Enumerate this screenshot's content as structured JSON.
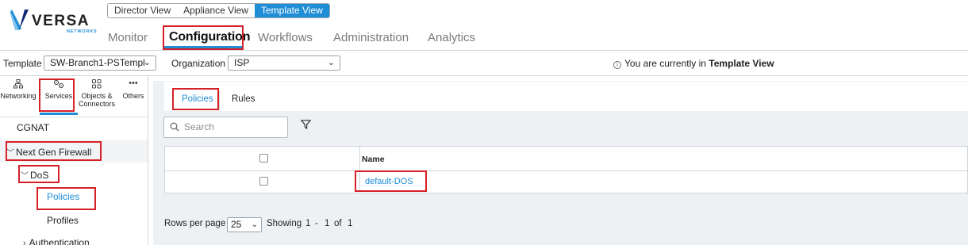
{
  "brand": {
    "name": "VERSA",
    "sub": "NETWORKS",
    "colors": [
      "#0e2a74",
      "#1f8ed6",
      "#7ec2ee"
    ]
  },
  "view_switch": {
    "items": [
      "Director View",
      "Appliance View",
      "Template View"
    ],
    "active": "Template View"
  },
  "main_nav": {
    "items": [
      "Monitor",
      "Configuration",
      "Workflows",
      "Administration",
      "Analytics"
    ],
    "active": "Configuration"
  },
  "context_bar": {
    "template_label": "Template",
    "template_value": "SW-Branch1-PSTempl",
    "org_label": "Organization",
    "org_value": "ISP",
    "info_prefix": "You are currently in",
    "info_view": "Template View"
  },
  "categories": [
    {
      "label": "Networking",
      "icon": "network-icon"
    },
    {
      "label": "Services",
      "icon": "services-icon"
    },
    {
      "label": "Objects & Connectors",
      "label_line1": "Objects &",
      "label_line2": "Connectors",
      "icon": "objects-icon"
    },
    {
      "label": "Others",
      "icon": "more-icon"
    }
  ],
  "active_category": "Services",
  "tree": {
    "cgnat": "CGNAT",
    "ngfw": "Next Gen Firewall",
    "dos": "DoS",
    "policies": "Policies",
    "profiles": "Profiles",
    "authentication": "Authentication"
  },
  "content_tabs": {
    "items": [
      "Policies",
      "Rules"
    ],
    "active": "Policies"
  },
  "search": {
    "placeholder": "Search"
  },
  "table": {
    "columns": [
      "",
      "Name"
    ],
    "rows": [
      {
        "name": "default-DOS"
      }
    ]
  },
  "pagination": {
    "rows_per_page_label": "Rows per page",
    "rows_per_page": "25",
    "showing_label": "Showing",
    "from": "1",
    "dash": "-",
    "to": "1",
    "of_label": "of",
    "total": "1"
  },
  "accent_color": "#1f8ed6",
  "highlight_color": "#d62027"
}
